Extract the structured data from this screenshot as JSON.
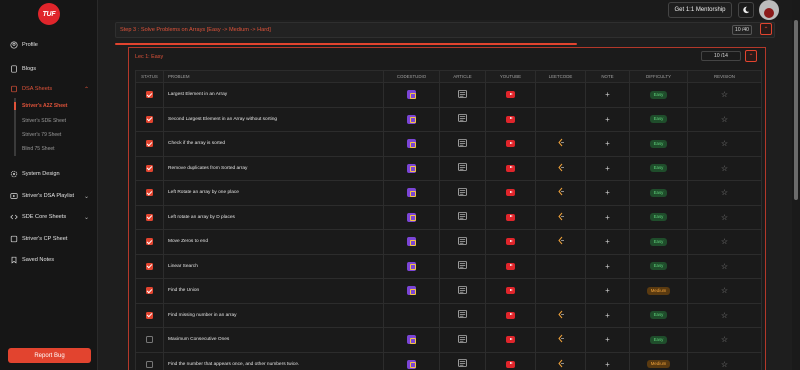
{
  "brand": {
    "logo_text": "TUF"
  },
  "sidebar": {
    "items": [
      {
        "label": "Profile",
        "icon": "user-circle-icon"
      },
      {
        "label": "Blogs",
        "icon": "document-icon"
      },
      {
        "label": "DSA Sheets",
        "icon": "book-icon",
        "expanded": true
      },
      {
        "label": "System Design",
        "icon": "gear-icon"
      },
      {
        "label": "Striver's DSA Playlist",
        "icon": "play-icon"
      },
      {
        "label": "SDE Core Sheets",
        "icon": "code-icon"
      },
      {
        "label": "Striver's CP Sheet",
        "icon": "chart-icon"
      },
      {
        "label": "Saved Notes",
        "icon": "bookmark-icon"
      }
    ],
    "dsa_sub": [
      {
        "label": "Striver's A2Z Sheet",
        "active": true
      },
      {
        "label": "Striver's SDE Sheet"
      },
      {
        "label": "Striver's 79 Sheet"
      },
      {
        "label": "Blind 75 Sheet"
      }
    ],
    "report_bug": "Report Bug"
  },
  "header": {
    "mentorship": "Get 1:1 Mentorship"
  },
  "step": {
    "title": "Step 3 : Solve Problems on Arrays [Easy -> Medium -> Hard]",
    "count": "10 /40",
    "progress": 0.25
  },
  "lecture": {
    "title": "Lec 1: Easy",
    "count": "10 /14"
  },
  "table": {
    "headers": [
      "STATUS",
      "PROBLEM",
      "CODESTUDIO",
      "ARTICLE",
      "YOUTUBE",
      "LEETCODE",
      "NOTE",
      "DIFFICULTY",
      "REVISION"
    ],
    "rows": [
      {
        "done": true,
        "problem": "Largest Element in an Array",
        "codestudio": true,
        "article": true,
        "youtube": true,
        "leetcode": false,
        "difficulty": "Easy"
      },
      {
        "done": true,
        "problem": "Second Largest Element in an Array without sorting",
        "codestudio": true,
        "article": true,
        "youtube": true,
        "leetcode": false,
        "difficulty": "Easy"
      },
      {
        "done": true,
        "problem": "Check if the array is sorted",
        "codestudio": true,
        "article": true,
        "youtube": true,
        "leetcode": true,
        "difficulty": "Easy"
      },
      {
        "done": true,
        "problem": "Remove duplicates from Sorted array",
        "codestudio": true,
        "article": true,
        "youtube": true,
        "leetcode": true,
        "difficulty": "Easy"
      },
      {
        "done": true,
        "problem": "Left Rotate an array by one place",
        "codestudio": true,
        "article": true,
        "youtube": true,
        "leetcode": true,
        "difficulty": "Easy"
      },
      {
        "done": true,
        "problem": "Left rotate an array by D places",
        "codestudio": true,
        "article": true,
        "youtube": true,
        "leetcode": true,
        "difficulty": "Easy"
      },
      {
        "done": true,
        "problem": "Move Zeros to end",
        "codestudio": true,
        "article": true,
        "youtube": true,
        "leetcode": true,
        "difficulty": "Easy"
      },
      {
        "done": true,
        "problem": "Linear Search",
        "codestudio": true,
        "article": true,
        "youtube": true,
        "leetcode": false,
        "difficulty": "Easy"
      },
      {
        "done": true,
        "problem": "Find the Union",
        "codestudio": true,
        "article": true,
        "youtube": true,
        "leetcode": false,
        "difficulty": "Medium"
      },
      {
        "done": true,
        "problem": "Find missing number in an array",
        "codestudio": false,
        "article": true,
        "youtube": true,
        "leetcode": true,
        "difficulty": "Easy"
      },
      {
        "done": false,
        "problem": "Maximum Consecutive Ones",
        "codestudio": true,
        "article": true,
        "youtube": true,
        "leetcode": true,
        "difficulty": "Easy"
      },
      {
        "done": false,
        "problem": "Find the number that appears once, and other numbers twice.",
        "codestudio": true,
        "article": true,
        "youtube": true,
        "leetcode": true,
        "difficulty": "Medium"
      }
    ]
  },
  "colors": {
    "accent": "#e2442f",
    "easy": "#5fd07a",
    "medium": "#f0a23a"
  }
}
